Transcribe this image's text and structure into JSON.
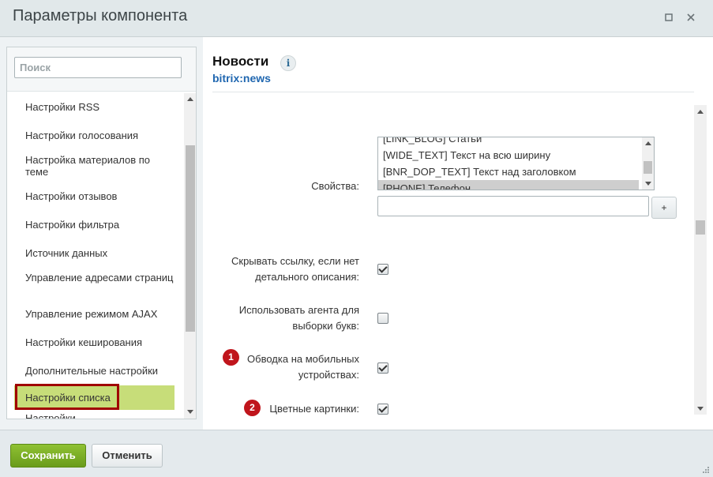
{
  "window": {
    "title": "Параметры компонента",
    "minimize_icon": "square-icon",
    "close_icon": "close-icon"
  },
  "sidebar": {
    "search_placeholder": "Поиск",
    "items": [
      {
        "label": "Настройки RSS"
      },
      {
        "label": "Настройки голосования"
      },
      {
        "label": "Настройка материалов по теме"
      },
      {
        "label": "Настройки отзывов"
      },
      {
        "label": "Настройки фильтра"
      },
      {
        "label": "Источник данных"
      },
      {
        "label": "Управление адресами страниц"
      },
      {
        "label": "Управление режимом AJAX"
      },
      {
        "label": "Настройки кеширования"
      },
      {
        "label": "Дополнительные настройки"
      },
      {
        "label": "Настройки списка",
        "active": true
      },
      {
        "label": "Настройки"
      }
    ]
  },
  "component": {
    "title": "Новости",
    "info_icon": "info-icon",
    "code": "bitrix:news"
  },
  "form": {
    "properties": {
      "label": "Свойства:",
      "options": [
        {
          "label": "[LINK_BLOG] Статьи"
        },
        {
          "label": "[WIDE_TEXT] Текст на всю ширину"
        },
        {
          "label": "[BNR_DOP_TEXT] Текст над заголовком"
        },
        {
          "label": "[PHONE] Телефон",
          "selected": true
        }
      ],
      "input_value": "",
      "add_button": "+"
    },
    "hide_link": {
      "label_line1": "Скрывать ссылку, если нет",
      "label_line2": "детального описания:",
      "checked": true
    },
    "use_agent": {
      "label_line1": "Использовать агента для",
      "label_line2": "выборки букв:",
      "checked": false
    },
    "mobile_border": {
      "badge": "1",
      "label_line1": "Обводка на мобильных",
      "label_line2": "устройствах:",
      "checked": true
    },
    "color_images": {
      "badge": "2",
      "label": "Цветные картинки:",
      "checked": true
    }
  },
  "footer": {
    "save_label": "Сохранить",
    "cancel_label": "Отменить"
  },
  "colors": {
    "active_item_bg": "#c7dd79",
    "highlight_outline": "#a00000",
    "badge": "#c0151c",
    "save_button": "#7aab24",
    "link_blue": "#2067b0"
  }
}
